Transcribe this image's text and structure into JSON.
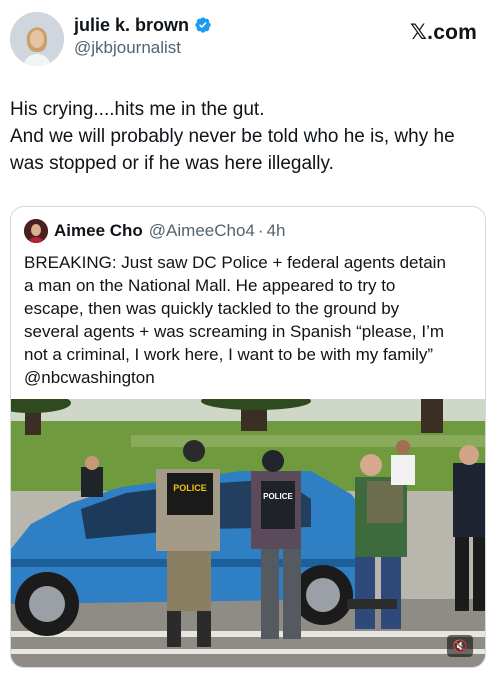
{
  "brand": {
    "logo_x": "𝕏",
    "logo_suffix": ".com"
  },
  "author": {
    "display_name": "julie k. brown",
    "handle": "@jkbjournalist",
    "verified": true
  },
  "tweet": {
    "lines": [
      "His crying....hits me in the gut.",
      "And we will probably never be told who he is, why he",
      "was stopped or if he was here illegally."
    ]
  },
  "quote": {
    "display_name": "Aimee Cho",
    "handle": "@AimeeCho4",
    "separator": "·",
    "time": "4h",
    "lines": [
      "BREAKING: Just saw DC Police + federal agents detain",
      "a man on the National Mall. He appeared to try to",
      "escape, then was quickly tackled to the ground by",
      "several agents + was screaming in Spanish “please, I’m",
      "not a criminal, I work here, I want to be with my family”",
      "@nbcwashington"
    ],
    "media": {
      "vest_text_left": "POLICE",
      "vest_text_right": "POLICE",
      "mute_icon": "speaker-muted-icon"
    }
  },
  "colors": {
    "verified_blue": "#1d9bf0",
    "car_blue": "#2f7fc4",
    "grass": "#6f9a3e"
  }
}
